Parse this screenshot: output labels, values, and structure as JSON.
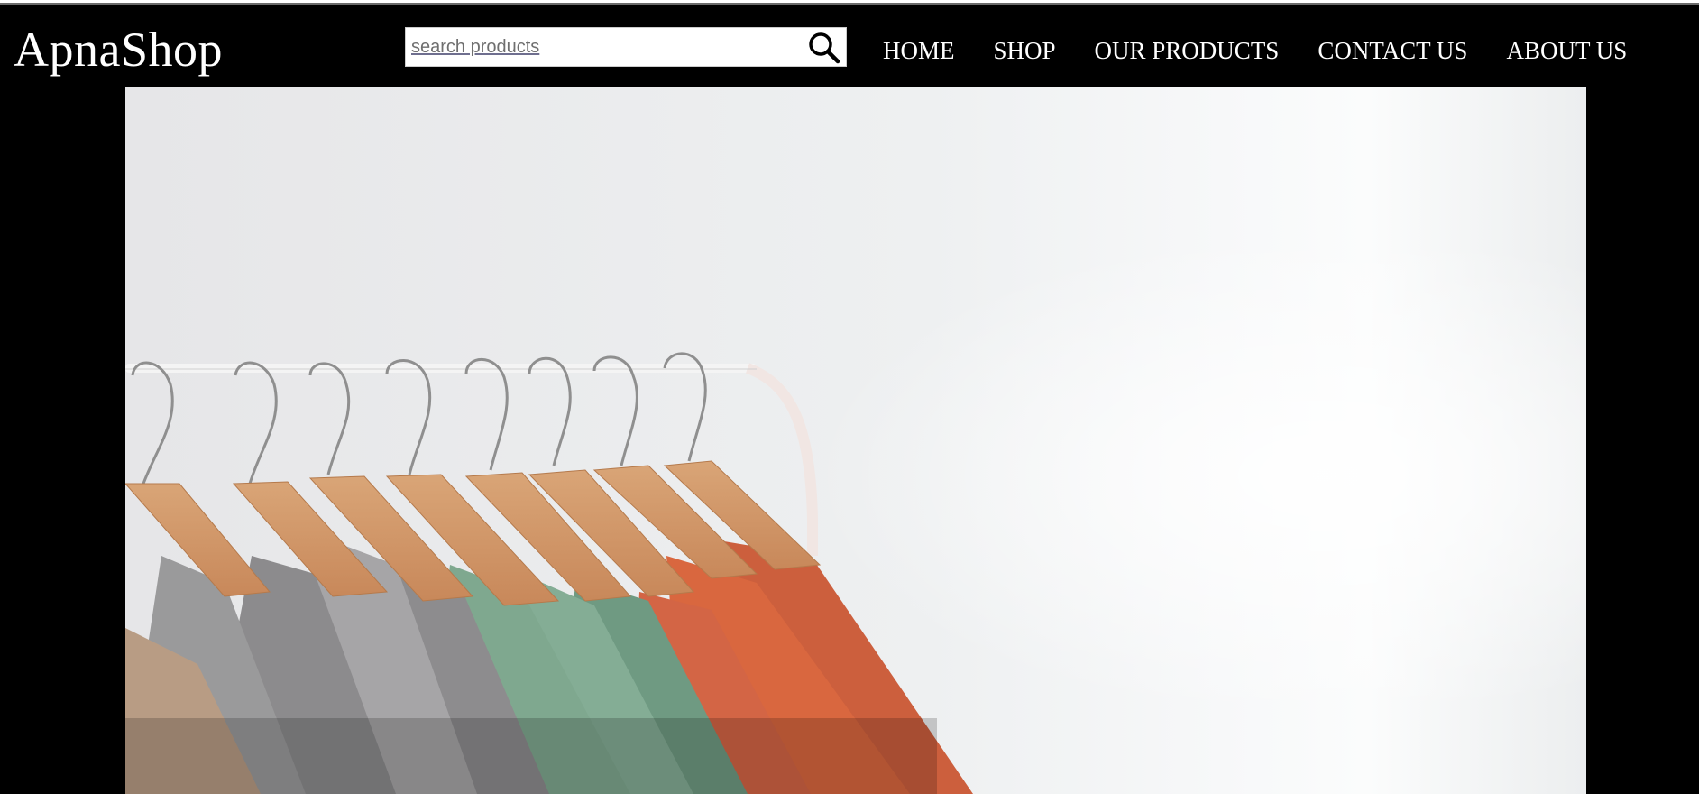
{
  "brand": {
    "name": "ApnaShop"
  },
  "search": {
    "placeholder": "search products",
    "value": "",
    "icon": "search-icon"
  },
  "nav": {
    "items": [
      {
        "label": "HOME"
      },
      {
        "label": "SHOP"
      },
      {
        "label": "OUR PRODUCTS"
      },
      {
        "label": "CONTACT US"
      },
      {
        "label": "ABOUT US"
      }
    ]
  },
  "hero": {
    "image_subject": "clothing-rack-with-shirts",
    "colors": {
      "background": "#000000",
      "hero_bg": "#ededee"
    }
  }
}
